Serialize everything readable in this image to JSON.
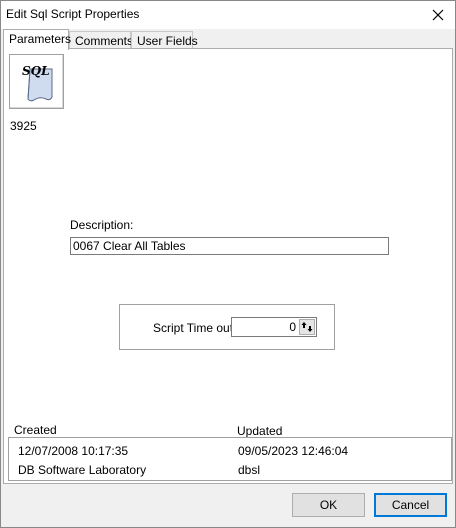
{
  "window": {
    "title": "Edit Sql Script Properties"
  },
  "tabs": [
    {
      "label": "Parameters",
      "active": true
    },
    {
      "label": "Comments",
      "active": false
    },
    {
      "label": "User Fields",
      "active": false
    }
  ],
  "parameters": {
    "icon": "sql-script-icon",
    "icon_text": "SQL",
    "id": "3925",
    "description_label": "Description:",
    "description_value": "0067 Clear All Tables",
    "timeout_label": "Script Time out:",
    "timeout_value": "0"
  },
  "audit": {
    "created_label": "Created",
    "updated_label": "Updated",
    "created_date": "12/07/2008 10:17:35",
    "updated_date": "09/05/2023 12:46:04",
    "created_by": "DB Software Laboratory",
    "updated_by": "dbsl"
  },
  "buttons": {
    "ok": "OK",
    "cancel": "Cancel"
  },
  "colors": {
    "focus_border": "#0078d7",
    "button_face": "#e1e1e1",
    "window_bg": "#f0f0f0"
  }
}
